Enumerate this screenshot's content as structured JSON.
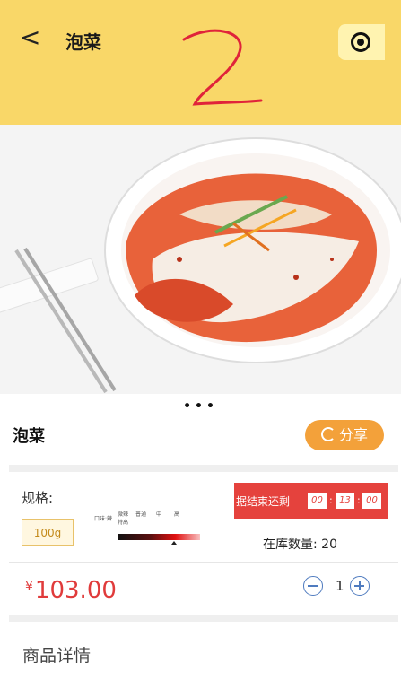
{
  "nav": {
    "back_icon": "chevron-left-icon",
    "back_glyph": "<",
    "title": "泡菜",
    "scan_icon": "target-icon"
  },
  "product": {
    "name": "泡菜",
    "share_label": "分享",
    "share_icon": "refresh-share-icon",
    "spec_label": "规格:",
    "spec_options": [
      "100g"
    ],
    "heat_scale": {
      "labels": [
        "微辣",
        "普通",
        "中",
        "高",
        "特高"
      ],
      "side_label": "口味:辣"
    },
    "countdown_label": "据结束还剩",
    "countdown": {
      "hours": "00",
      "minutes": "13",
      "seconds": "00"
    },
    "stock_label": "在库数量:",
    "stock_value": "20",
    "price": "¥103.00",
    "price_currency": "¥",
    "price_amount": "103.00",
    "quantity": "1",
    "minus_icon": "minus-circle-icon",
    "plus_icon": "plus-circle-icon"
  },
  "carousel": {
    "indicator": "•••"
  },
  "detail": {
    "title": "商品详情"
  },
  "colors": {
    "header_bg": "#f9d768",
    "accent_orange": "#f3a13a",
    "price_red": "#e03b3b",
    "countdown_red": "#e5423d",
    "qty_blue": "#4f7bbf"
  }
}
